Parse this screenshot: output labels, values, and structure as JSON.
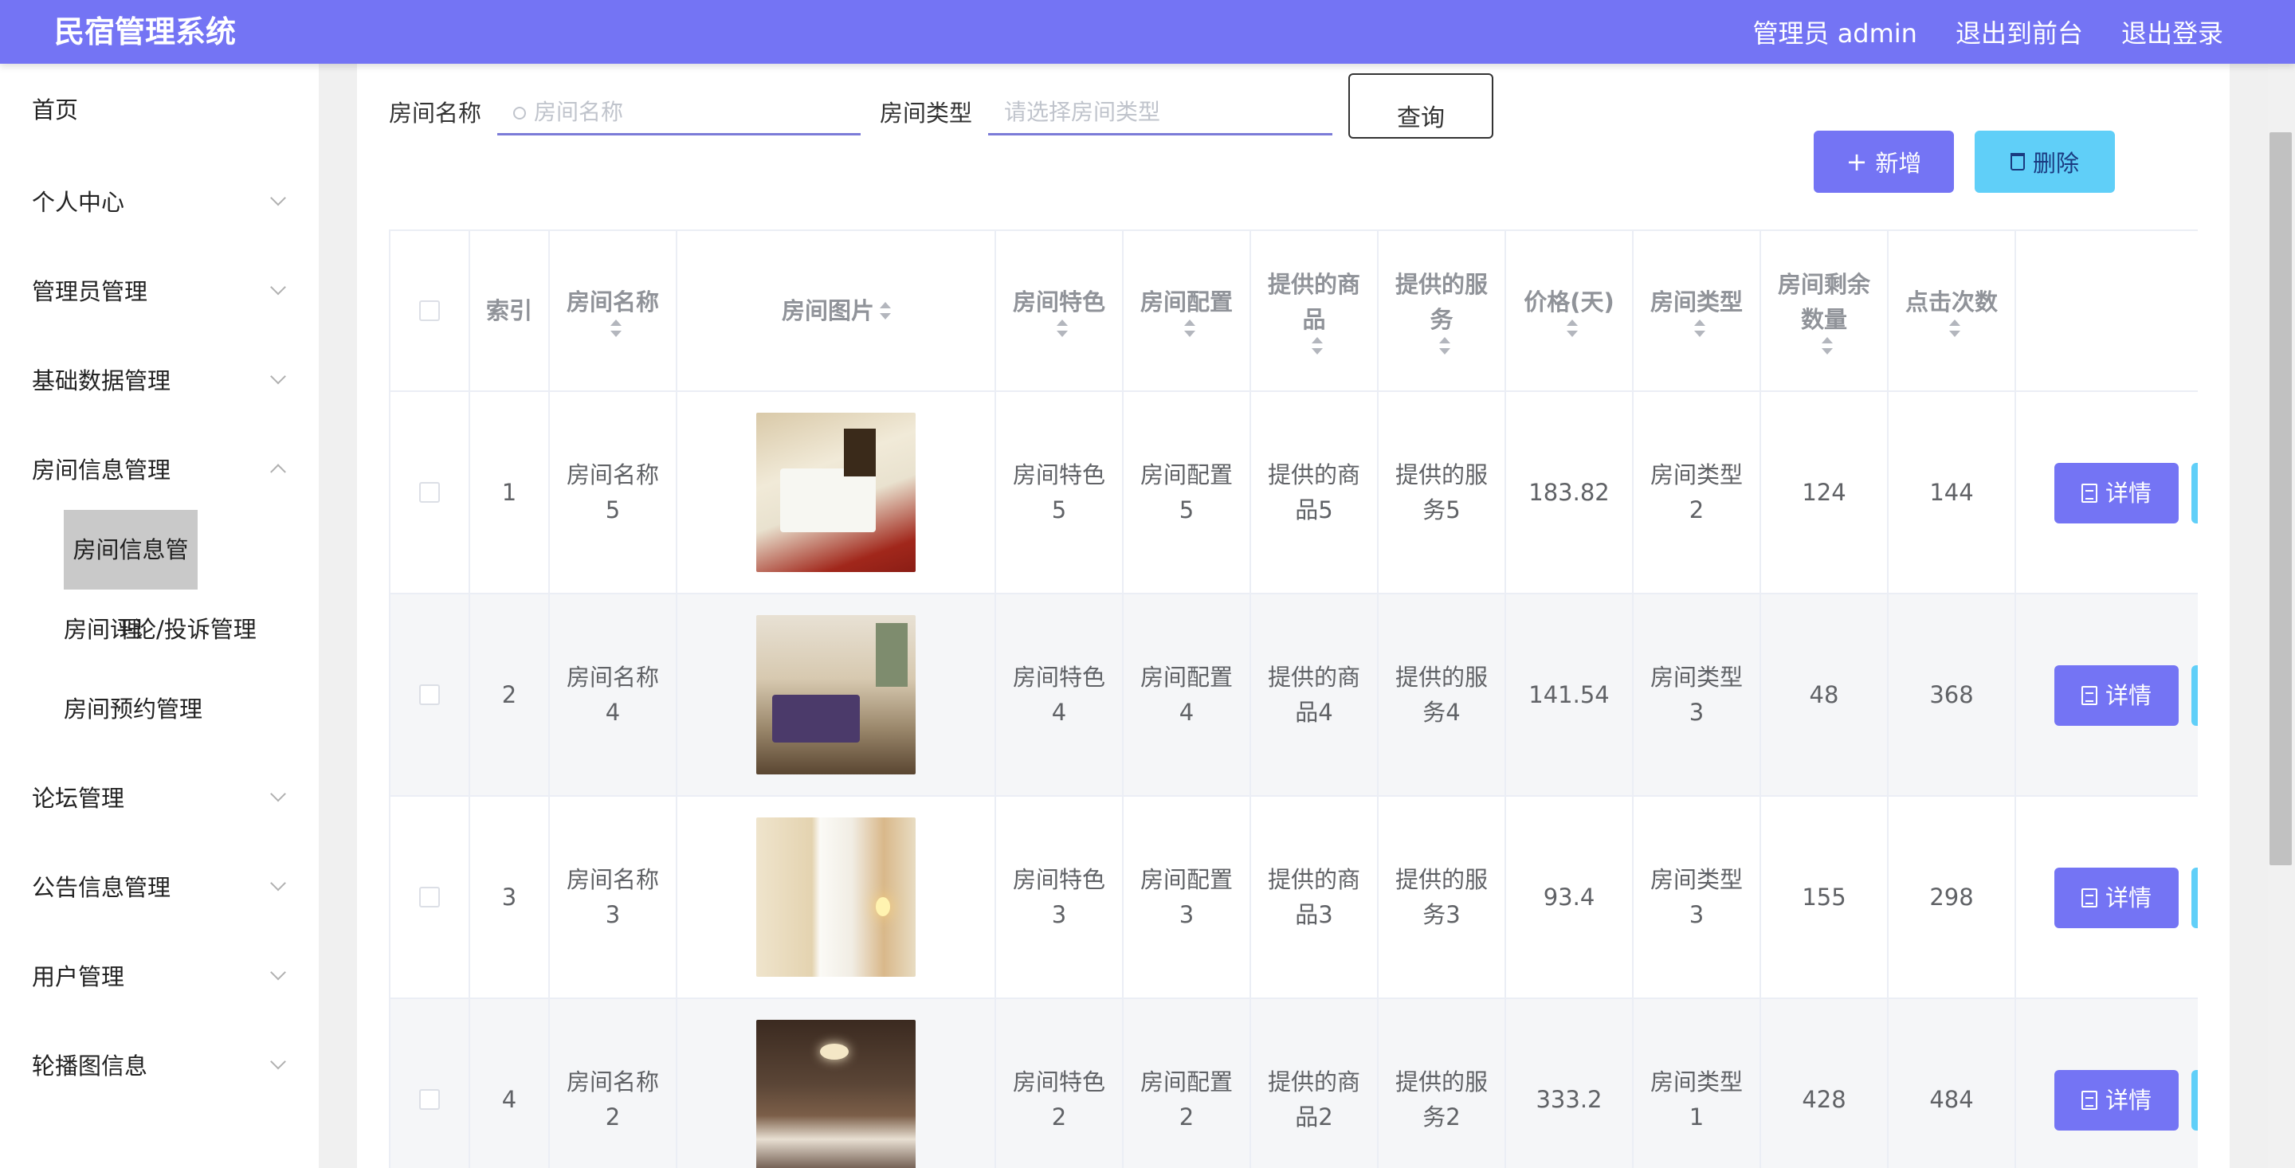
{
  "header": {
    "title": "民宿管理系统",
    "admin_label": "管理员 admin",
    "front_link": "退出到前台",
    "logout_link": "退出登录"
  },
  "sidebar": {
    "items": [
      {
        "label": "首页"
      },
      {
        "label": "个人中心"
      },
      {
        "label": "管理员管理"
      },
      {
        "label": "基础数据管理"
      },
      {
        "label": "房间信息管理"
      },
      {
        "label": "论坛管理"
      },
      {
        "label": "公告信息管理"
      },
      {
        "label": "用户管理"
      },
      {
        "label": "轮播图信息"
      }
    ],
    "sub_items": [
      {
        "label": "房间信息管理",
        "active": true
      },
      {
        "label": "房间评论/投诉管理"
      },
      {
        "label": "房间预约管理"
      }
    ]
  },
  "search": {
    "name_label": "房间名称",
    "name_placeholder": "房间名称",
    "type_label": "房间类型",
    "type_placeholder": "请选择房间类型",
    "query_label": "查询"
  },
  "actions": {
    "add_label": "新增",
    "delete_label": "删除",
    "detail_label": "详情"
  },
  "table": {
    "headers": {
      "index": "索引",
      "name": "房间名称",
      "image": "房间图片",
      "feature": "房间特色",
      "config": "房间配置",
      "goods": "提供的商品",
      "service": "提供的服务",
      "price": "价格(天)",
      "type": "房间类型",
      "remain": "房间剩余数量",
      "clicks": "点击次数"
    },
    "rows": [
      {
        "index": "1",
        "name": "房间名称5",
        "feature": "房间特色5",
        "config": "房间配置5",
        "goods": "提供的商品5",
        "service": "提供的服务5",
        "price": "183.82",
        "type": "房间类型2",
        "remain": "124",
        "clicks": "144"
      },
      {
        "index": "2",
        "name": "房间名称4",
        "feature": "房间特色4",
        "config": "房间配置4",
        "goods": "提供的商品4",
        "service": "提供的服务4",
        "price": "141.54",
        "type": "房间类型3",
        "remain": "48",
        "clicks": "368"
      },
      {
        "index": "3",
        "name": "房间名称3",
        "feature": "房间特色3",
        "config": "房间配置3",
        "goods": "提供的商品3",
        "service": "提供的服务3",
        "price": "93.4",
        "type": "房间类型3",
        "remain": "155",
        "clicks": "298"
      },
      {
        "index": "4",
        "name": "房间名称2",
        "feature": "房间特色2",
        "config": "房间配置2",
        "goods": "提供的商品2",
        "service": "提供的服务2",
        "price": "333.2",
        "type": "房间类型1",
        "remain": "428",
        "clicks": "484"
      }
    ]
  },
  "colors": {
    "primary": "#7474f4",
    "info": "#60cff8",
    "sidebar_active": "#c9c9c9"
  }
}
